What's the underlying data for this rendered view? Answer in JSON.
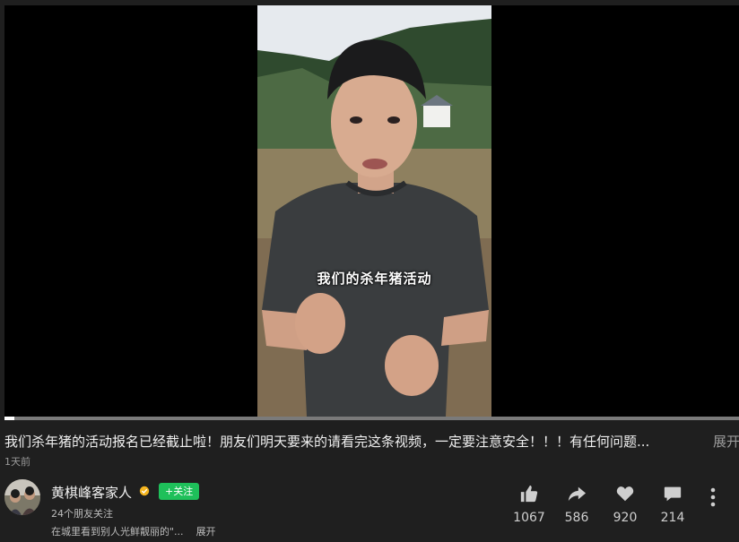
{
  "video": {
    "subtitle": "我们的杀年猪活动",
    "progress_fraction": 0.013
  },
  "post": {
    "title": "我们杀年猪的活动报名已经截止啦！朋友们明天要来的请看完这条视频，一定要注意安全！！！有任何问题...",
    "expand_label": "展开",
    "time_ago": "1天前"
  },
  "author": {
    "name": "黄棋峰客家人",
    "follow_label": "+关注",
    "friends": "24个朋友关注",
    "description": "在城里看到别人光鲜靓丽的\"...",
    "description_expand": "展开"
  },
  "stats": {
    "likes": "1067",
    "shares": "586",
    "favorites": "920",
    "comments": "214"
  },
  "icons": [
    "thumbs-up-icon",
    "share-icon",
    "heart-icon",
    "comment-icon",
    "more-vertical-icon",
    "verified-icon"
  ]
}
